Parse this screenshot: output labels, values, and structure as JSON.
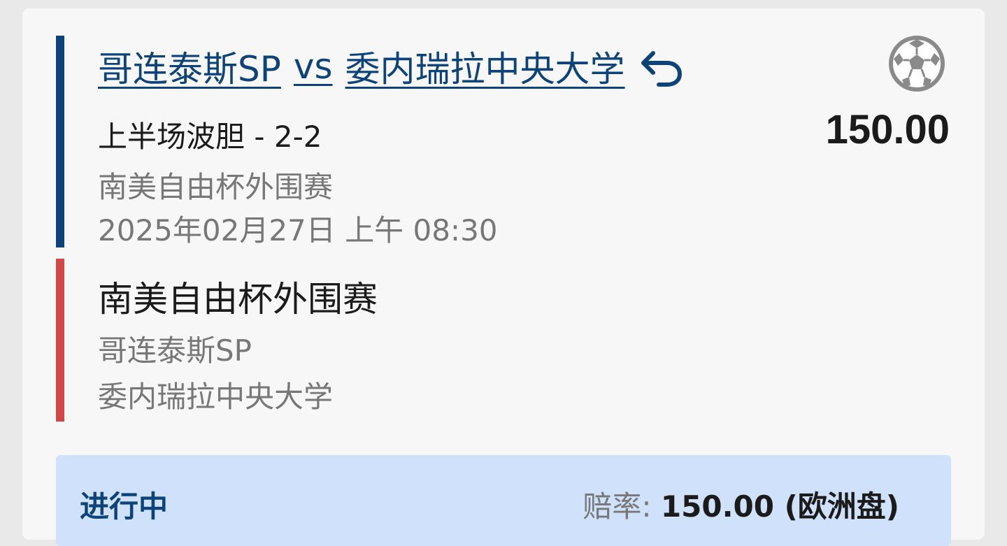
{
  "bet": {
    "home_team": "哥连泰斯SP",
    "vs": "vs",
    "away_team": "委内瑞拉中央大学",
    "odds": "150.00",
    "market": "上半场波胆 - 2-2",
    "league": "南美自由杯外围赛",
    "datetime": "2025年02月27日 上午 08:30"
  },
  "event": {
    "league": "南美自由杯外围赛",
    "team1": "哥连泰斯SP",
    "team2": "委内瑞拉中央大学"
  },
  "status": {
    "label": "进行中",
    "odds_label": "赔率:",
    "odds_value": "150.00 (欧洲盘)"
  },
  "icons": {
    "back": "undo-arrow-icon",
    "sport": "soccer-ball-icon"
  },
  "colors": {
    "primary": "#0d4378",
    "accent_red": "#d04848",
    "status_bg": "#cfe1fb"
  }
}
